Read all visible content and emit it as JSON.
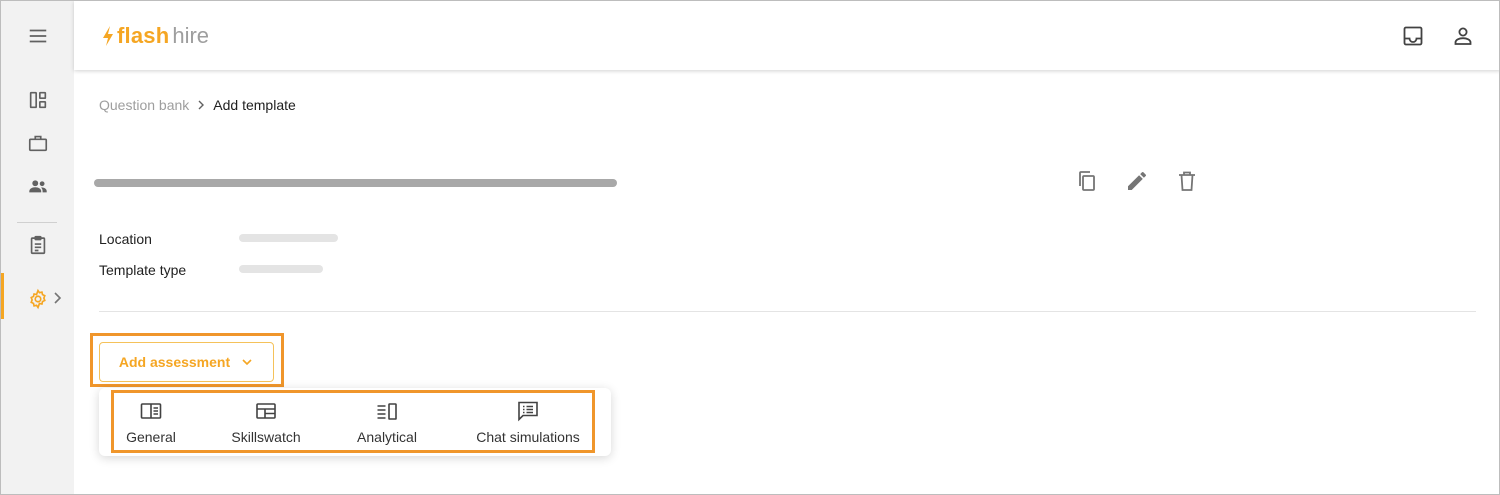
{
  "app": {
    "brand_part1": "flash",
    "brand_part2": "hire"
  },
  "colors": {
    "accent": "#f5a623",
    "highlight": "#f0962b",
    "icon_gray": "#757575"
  },
  "sidebar": {
    "items": [
      {
        "name": "menu-icon"
      },
      {
        "name": "dashboard-icon"
      },
      {
        "name": "briefcase-icon"
      },
      {
        "name": "people-icon"
      },
      {
        "name": "clipboard-icon"
      },
      {
        "name": "settings-icon",
        "active": true
      }
    ]
  },
  "header": {
    "icons": [
      "inbox-icon",
      "account-icon"
    ]
  },
  "breadcrumb": {
    "parent": "Question bank",
    "current": "Add template"
  },
  "template": {
    "actions": [
      "copy-icon",
      "edit-icon",
      "delete-icon"
    ],
    "fields": [
      {
        "label": "Location"
      },
      {
        "label": "Template type"
      }
    ]
  },
  "assessment": {
    "button_label": "Add assessment",
    "menu": [
      {
        "label": "General",
        "icon": "general-icon"
      },
      {
        "label": "Skillswatch",
        "icon": "skillswatch-icon"
      },
      {
        "label": "Analytical",
        "icon": "analytical-icon"
      },
      {
        "label": "Chat simulations",
        "icon": "chat-simulations-icon"
      }
    ]
  }
}
